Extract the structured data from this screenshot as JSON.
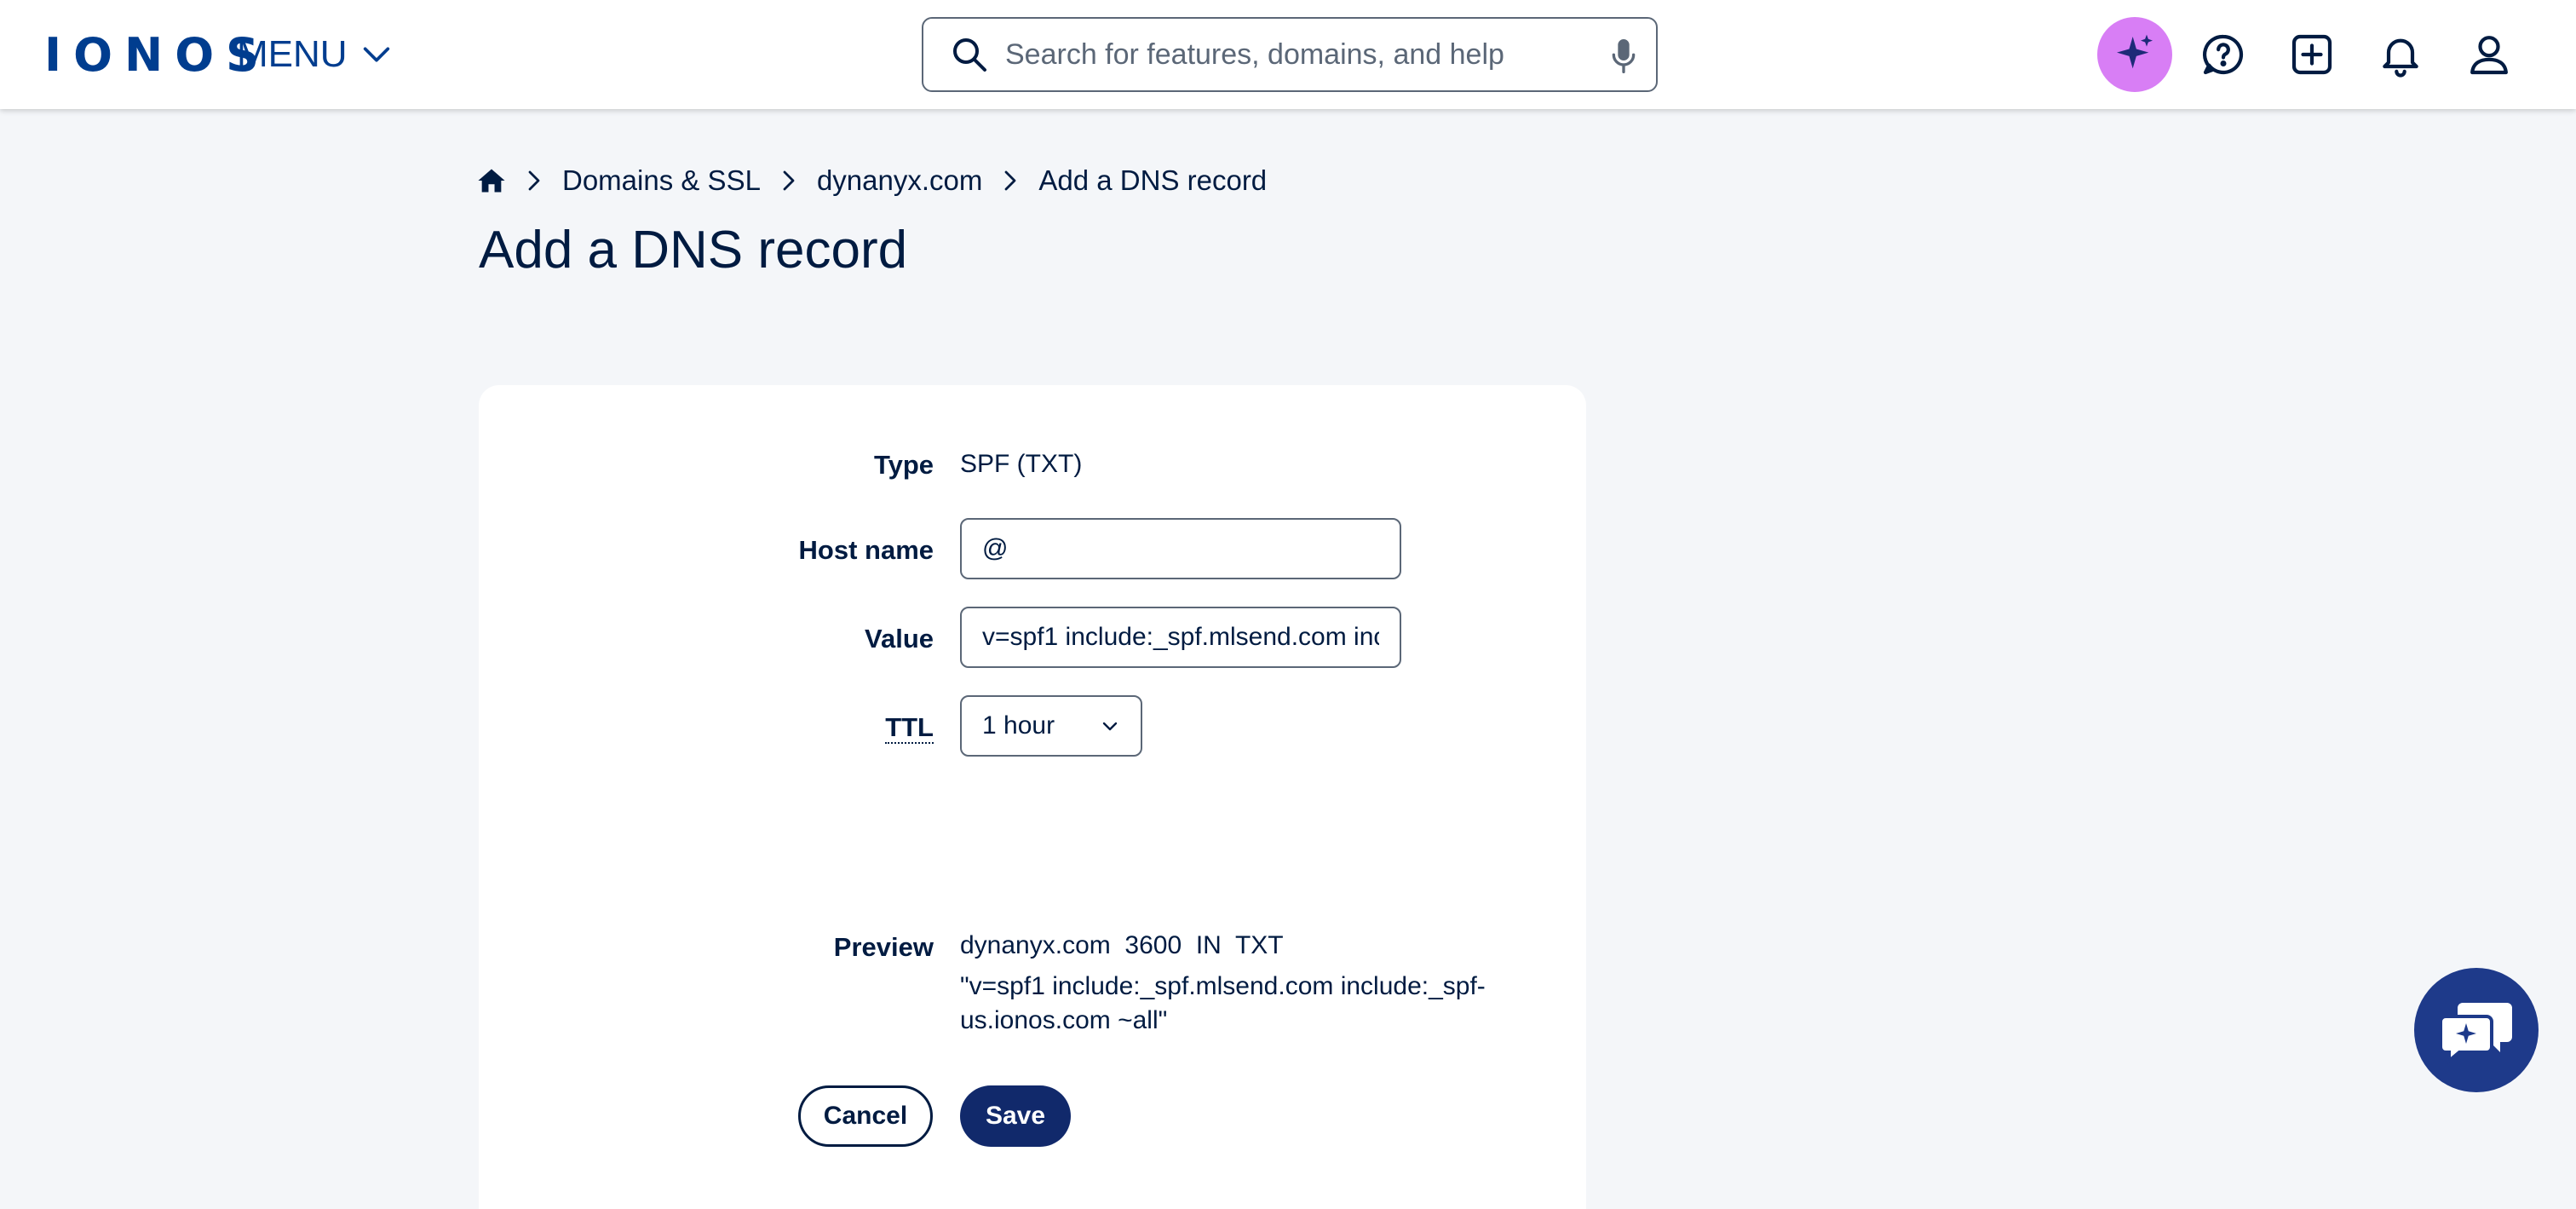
{
  "header": {
    "logo": "IONOS",
    "menu_label": "MENU",
    "search_placeholder": "Search for features, domains, and help"
  },
  "breadcrumb": {
    "items": [
      "Domains & SSL",
      "dynanyx.com",
      "Add a DNS record"
    ]
  },
  "page": {
    "title": "Add a DNS record"
  },
  "form": {
    "type_label": "Type",
    "type_value": "SPF (TXT)",
    "host_label": "Host name",
    "host_value": "@",
    "value_label": "Value",
    "value_value": "v=spf1 include:_spf.mlsend.com include:_spf-us.ionos.com ~all",
    "ttl_label": "TTL",
    "ttl_value": "1 hour",
    "preview_label": "Preview",
    "preview_line1": "dynanyx.com  3600  IN  TXT",
    "preview_line2": "\"v=spf1 include:_spf.mlsend.com include:_spf-us.ionos.com ~all\"",
    "cancel_label": "Cancel",
    "save_label": "Save"
  },
  "colors": {
    "brand": "#003d8f",
    "text": "#001b41",
    "background": "#f4f6f9",
    "ai_button": "#d87ef5",
    "save_button": "#11296b",
    "chat_fab": "#1e3a8a"
  },
  "icons": [
    "search-icon",
    "mic-icon",
    "ai-sparkle-icon",
    "help-icon",
    "add-icon",
    "bell-icon",
    "user-icon",
    "home-icon",
    "chevron-right-icon",
    "chevron-down-icon",
    "chat-icon"
  ]
}
